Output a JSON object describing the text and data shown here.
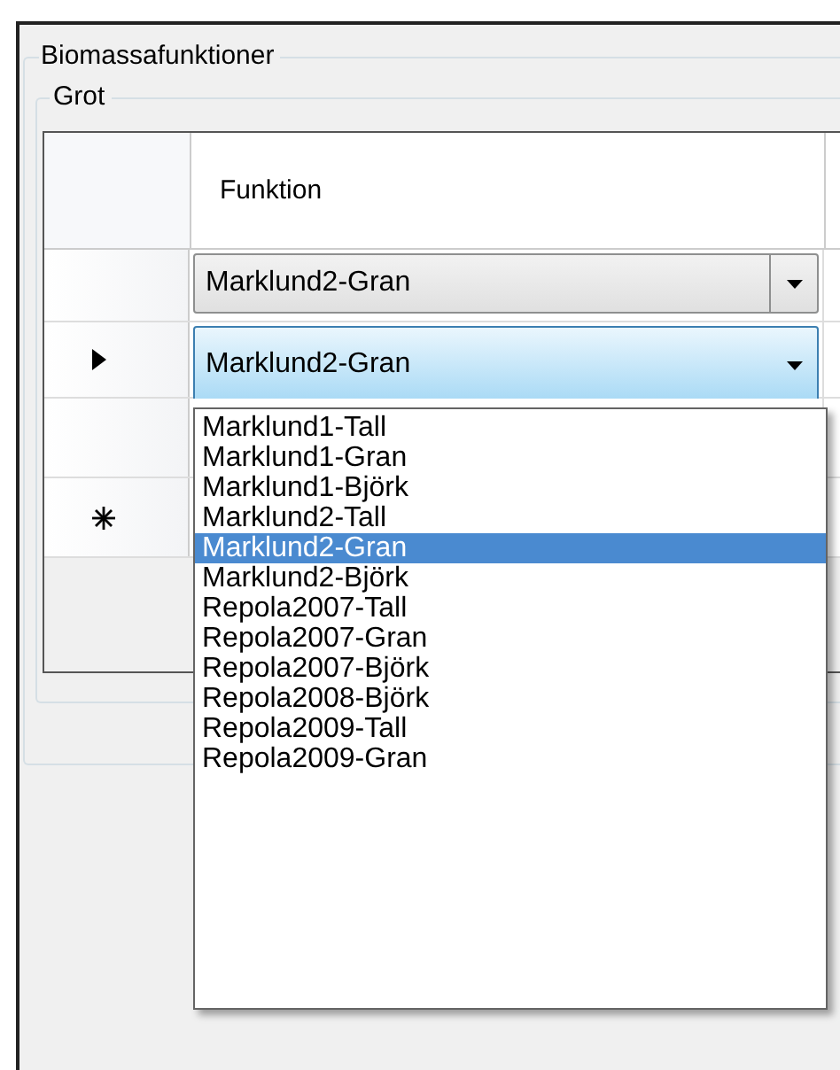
{
  "group": {
    "title": "Biomassafunktioner"
  },
  "subgroup": {
    "title": "Grot"
  },
  "grid": {
    "columns": [
      "Funktion"
    ],
    "rows": [
      {
        "kind": "data",
        "current": false,
        "value": "Marklund2-Gran",
        "open": false
      },
      {
        "kind": "data",
        "current": true,
        "value": "Marklund2-Gran",
        "open": true
      },
      {
        "kind": "data",
        "current": false
      },
      {
        "kind": "new",
        "current": false
      }
    ]
  },
  "dropdown": {
    "items": [
      {
        "label": "Marklund1-Tall",
        "selected": false
      },
      {
        "label": "Marklund1-Gran",
        "selected": false
      },
      {
        "label": "Marklund1-Björk",
        "selected": false
      },
      {
        "label": "Marklund2-Tall",
        "selected": false
      },
      {
        "label": "Marklund2-Gran",
        "selected": true
      },
      {
        "label": "Marklund2-Björk",
        "selected": false
      },
      {
        "label": "Repola2007-Tall",
        "selected": false
      },
      {
        "label": "Repola2007-Gran",
        "selected": false
      },
      {
        "label": "Repola2007-Björk",
        "selected": false
      },
      {
        "label": "Repola2008-Björk",
        "selected": false
      },
      {
        "label": "Repola2009-Tall",
        "selected": false
      },
      {
        "label": "Repola2009-Gran",
        "selected": false
      }
    ]
  }
}
